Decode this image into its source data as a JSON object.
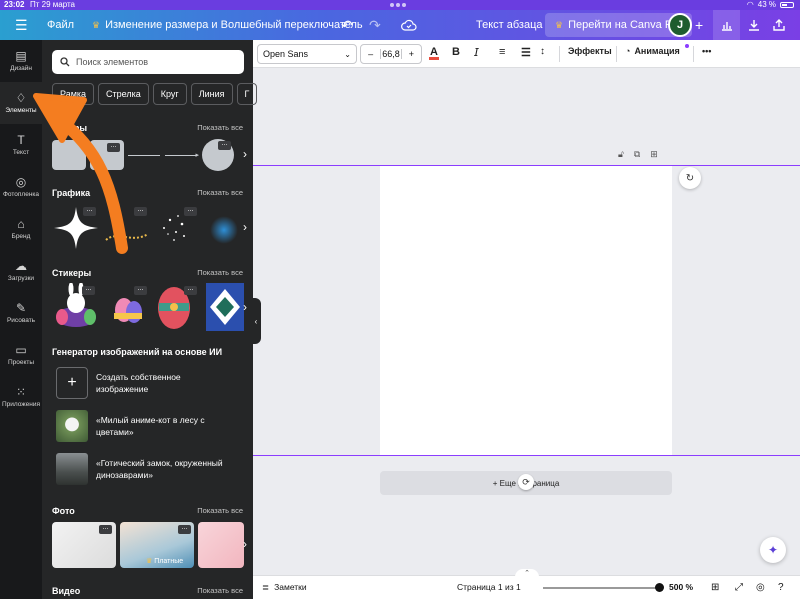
{
  "status": {
    "time": "23:02",
    "date": "Пт 29 марта",
    "battery": "43 %"
  },
  "topbar": {
    "file": "Файл",
    "doc_title": "Изменение размера и Волшебный переключатель",
    "text_style": "Текст абзаца",
    "pro_label": "Перейти на Canva Pro",
    "avatar_letter": "J"
  },
  "rail": [
    {
      "label": "Дизайн",
      "icon": "design-icon"
    },
    {
      "label": "Элементы",
      "icon": "elements-icon"
    },
    {
      "label": "Текст",
      "icon": "text-icon"
    },
    {
      "label": "Фотопленка",
      "icon": "camera-roll-icon"
    },
    {
      "label": "Бренд",
      "icon": "brand-icon"
    },
    {
      "label": "Загрузки",
      "icon": "upload-icon"
    },
    {
      "label": "Рисовать",
      "icon": "draw-icon"
    },
    {
      "label": "Проекты",
      "icon": "folder-icon"
    },
    {
      "label": "Приложения",
      "icon": "apps-icon"
    }
  ],
  "panel": {
    "search_placeholder": "Поиск элементов",
    "chips": [
      "Рамка",
      "Стрелка",
      "Круг",
      "Линия",
      "Г"
    ],
    "show_all": "Показать все",
    "sections": {
      "shapes": "Фигуры",
      "graphics": "Графика",
      "stickers": "Стикеры",
      "ai": "Генератор изображений на основе ИИ",
      "photos": "Фото",
      "video": "Видео"
    },
    "ai_items": [
      {
        "line1": "Создать собственное",
        "line2": "изображение"
      },
      {
        "line1": "«Милый аниме-кот в лесу с",
        "line2": "цветами»"
      },
      {
        "line1": "«Готический замок, окруженный",
        "line2": "динозаврами»"
      }
    ],
    "paid_badge": "Платные"
  },
  "toolbar": {
    "font": "Open Sans",
    "font_size": "66,8",
    "minus": "–",
    "plus": "+",
    "bold": "B",
    "effects": "Эффекты",
    "animation": "Анимация",
    "more": "•••"
  },
  "canvas": {
    "add_page": "+ Еще 1 страница"
  },
  "footer": {
    "notes": "Заметки",
    "page_info": "Страница 1 из 1",
    "zoom": "500 %"
  },
  "colors": {
    "accent": "#8b3dff",
    "arrow": "#f47d20",
    "panel": "#252627",
    "rail": "#18191b"
  }
}
